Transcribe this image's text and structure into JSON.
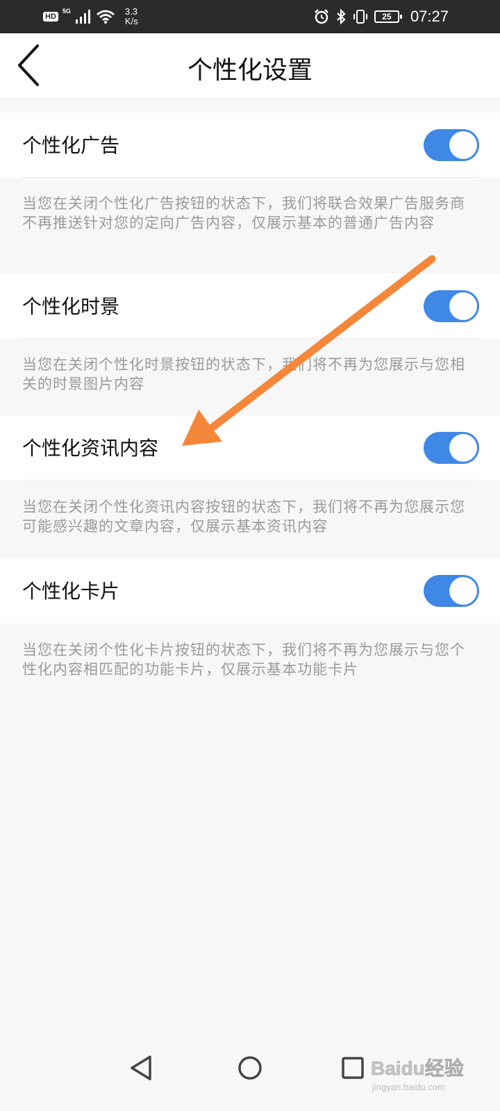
{
  "status_bar": {
    "hd": "HD",
    "network": "5G",
    "speed_value": "3.3",
    "speed_unit": "K/s",
    "battery": "25",
    "time": "07:27",
    "icons": [
      "signal-icon",
      "wifi-icon",
      "alarm-icon",
      "bluetooth-icon",
      "vibrate-icon",
      "battery-icon"
    ]
  },
  "header": {
    "title": "个性化设置",
    "back_icon": "back-chevron-icon"
  },
  "settings": [
    {
      "label": "个性化广告",
      "enabled": true,
      "description": "当您在关闭个性化广告按钮的状态下，我们将联合效果广告服务商不再推送针对您的定向广告内容，仅展示基本的普通广告内容"
    },
    {
      "label": "个性化时景",
      "enabled": true,
      "description": "当您在关闭个性化时景按钮的状态下，我们将不再为您展示与您相关的时景图片内容"
    },
    {
      "label": "个性化资讯内容",
      "enabled": true,
      "description": "当您在关闭个性化资讯内容按钮的状态下，我们将不再为您展示您可能感兴趣的文章内容，仅展示基本资讯内容"
    },
    {
      "label": "个性化卡片",
      "enabled": true,
      "description": "当您在关闭个性化卡片按钮的状态下，我们将不再为您展示与您个性化内容相匹配的功能卡片，仅展示基本功能卡片"
    }
  ],
  "colors": {
    "toggle_on": "#3f88e5",
    "annotation_arrow": "#f5873a",
    "status_bar_bg": "#2b2b2b"
  },
  "nav_bar": {
    "icons": [
      "back-triangle-icon",
      "home-circle-icon",
      "recents-square-icon"
    ]
  },
  "watermark": {
    "text": "Baidu经验",
    "subtext": "jingyan.baidu.com"
  }
}
